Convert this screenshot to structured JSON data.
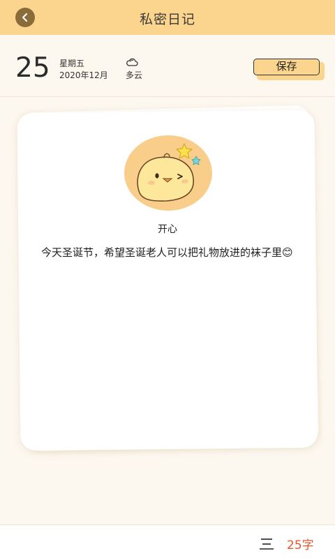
{
  "header": {
    "title": "私密日记",
    "back_icon": "chevron-left-icon"
  },
  "date": {
    "day": "25",
    "weekday": "星期五",
    "year_month": "2020年12月"
  },
  "weather": {
    "icon": "cloud-icon",
    "label": "多云"
  },
  "toolbar": {
    "save_label": "保存"
  },
  "entry": {
    "mood_icon": "happy-chick-icon",
    "mood": "开心",
    "text": "今天圣诞节，希望圣诞老人可以把礼物放进的袜子里😊"
  },
  "footer": {
    "menu_icon": "text-align-icon",
    "word_count": "25字"
  },
  "colors": {
    "header_bg": "#fbd48d",
    "page_bg": "#fcf7ef",
    "accent": "#e2582e",
    "back_button": "#8a6b3a",
    "avatar_bg": "#f8ce8a"
  }
}
